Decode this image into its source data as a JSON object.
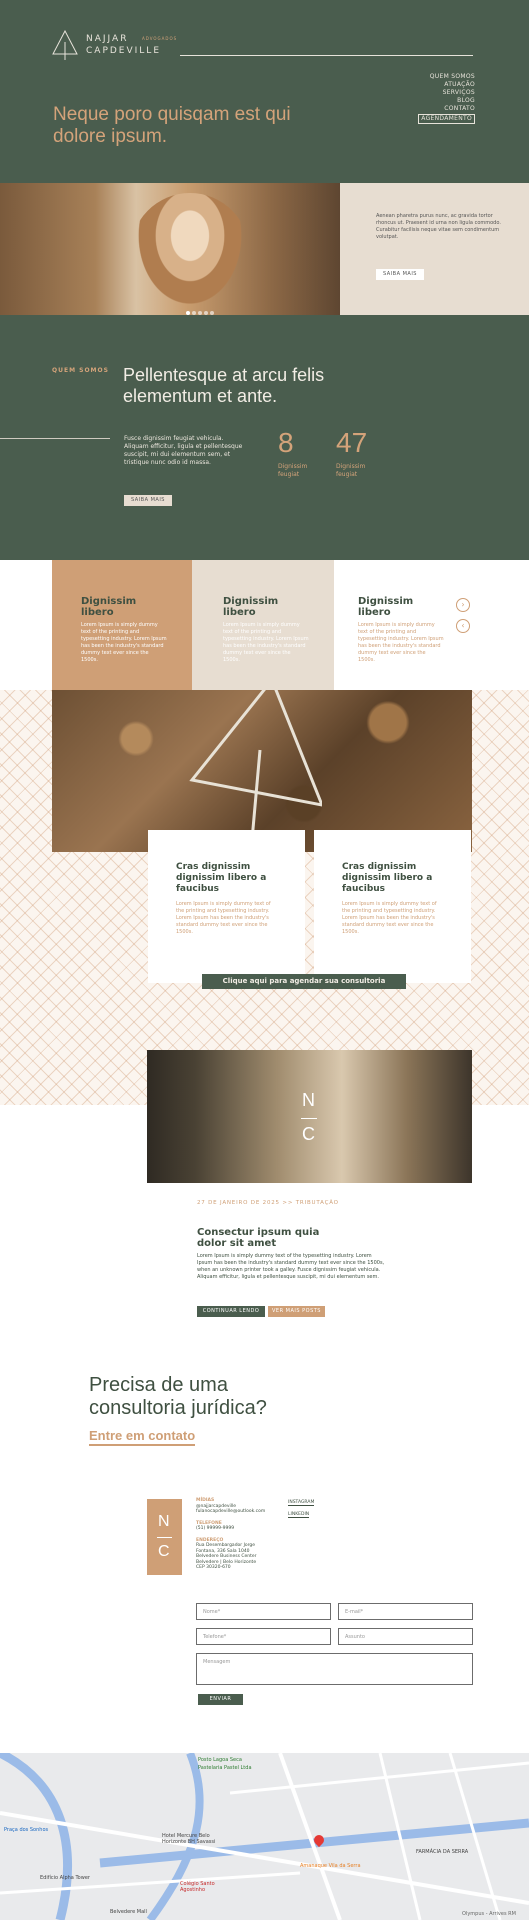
{
  "brand": {
    "name_line1": "NAJJAR",
    "name_line2": "CAPDEVILLE",
    "tagline": "ADVOGADOS"
  },
  "nav": {
    "items": [
      "QUEM SOMOS",
      "ATUAÇÃO",
      "SERVIÇOS",
      "BLOG",
      "CONTATO",
      "AGENDAMENTO"
    ]
  },
  "hero": {
    "headline": "Neque poro quisqam est qui dolore ipsum.",
    "side_text": "Aenean pharetra purus nunc, ac gravida tortor rhoncus ut. Praesent id urna non ligula commodo. Curabitur facilisis neque vitae sem condimentum volutpat.",
    "button": "SAIBA MAIS"
  },
  "about": {
    "label": "QUEM SOMOS",
    "title": "Pellentesque at arcu felis elementum et ante.",
    "text": "Fusce dignissim feugiat vehicula. Aliquam efficitur, ligula et pellentesque suscipit, mi dui elementum sem, et tristique nunc odio id massa.",
    "button": "SAIBA MAIS",
    "stats": [
      {
        "number": "8",
        "label": "Dignissim feugiat"
      },
      {
        "number": "47",
        "label": "Dignissim feugiat"
      }
    ]
  },
  "services": [
    {
      "title": "Dignissim libero",
      "text": "Lorem Ipsum is simply dummy text of the printing and typesetting industry. Lorem Ipsum has been the industry's standard dummy text ever since the 1500s."
    },
    {
      "title": "Dignissim libero",
      "text": "Lorem Ipsum is simply dummy text of the printing and typesetting industry. Lorem Ipsum has been the industry's standard dummy text ever since the 1500s."
    },
    {
      "title": "Dignissim libero",
      "text": "Lorem Ipsum is simply dummy text of the printing and typesetting industry. Lorem Ipsum has been the industry's standard dummy text ever since the 1500s."
    }
  ],
  "cards": [
    {
      "title": "Cras dignissim dignissim libero a faucibus",
      "text": "Lorem Ipsum is simply dummy text of the printing and typesetting industry. Lorem Ipsum has been the industry's standard dummy text ever since the 1500s."
    },
    {
      "title": "Cras dignissim dignissim libero a faucibus",
      "text": "Lorem Ipsum is simply dummy text of the printing and typesetting industry. Lorem Ipsum has been the industry's standard dummy text ever since the 1500s."
    }
  ],
  "cta_bar": "Clique aqui para agendar sua consultoria",
  "blog": {
    "meta": "27 DE JANEIRO DE 2025 >> TRIBUTAÇÃO",
    "title": "Consectur ipsum quia dolor sit amet",
    "text": "Lorem Ipsum is simply dummy text of the typesetting industry. Lorem Ipsum has been the industry's standard dummy text ever since the 1500s, when an unknown printer took a galley. Fusce dignissim feugiat vehicula. Aliquam efficitur, ligula et pellentesque suscipit, mi dui elementum sem.",
    "button_primary": "CONTINUAR LENDO",
    "button_secondary": "VER MAIS POSTS"
  },
  "consult": {
    "title": "Precisa de uma consultoria jurídica?",
    "link": "Entre em contato"
  },
  "contact": {
    "logo_top": "N",
    "logo_bottom": "C",
    "blocks": [
      {
        "label": "MÍDIAS",
        "lines": [
          "@najjarcapdeville",
          "fulanocapdeville@outlook.com"
        ]
      },
      {
        "label": "TELEFONE",
        "lines": [
          "(51) 99999-9999"
        ]
      },
      {
        "label": "ENDEREÇO",
        "lines": [
          "Rua Desembargador Jorge",
          "Fontana, 336 Sala 1040",
          "Belvedere Business Center",
          "Belvedere | Belo Horizonte",
          "CEP 30320-670"
        ]
      }
    ],
    "social": [
      "INSTAGRAM",
      "LINKEDIN"
    ]
  },
  "form": {
    "name": "Nome*",
    "email": "E-mail*",
    "phone": "Telefone*",
    "subject": "Assunto",
    "message": "Mensagem",
    "submit": "ENVIAR"
  },
  "map": {
    "labels": [
      "Posto Lagoa Seca",
      "Pastelaria Pastel Ltda",
      "Hotel Mercure Belo Horizonte BH Savassi",
      "FARMÁCIA DA SERRA",
      "Amanaque Vila da Serra",
      "Praça dos Sonhos",
      "Edifício Alpha Tower",
      "Colégio Santo Agostinho",
      "Belvedere Mall"
    ],
    "footer": "Olympus - Arrives RM"
  }
}
